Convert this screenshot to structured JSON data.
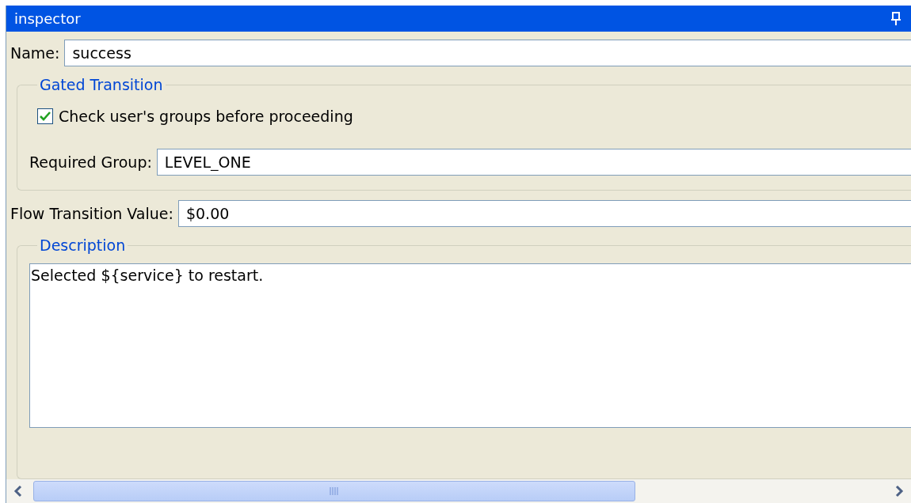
{
  "window": {
    "title": "inspector"
  },
  "name": {
    "label": "Name:",
    "value": "success"
  },
  "gated_transition": {
    "title": "Gated Transition",
    "checkbox": {
      "label": "Check user's groups before proceeding",
      "checked": true
    },
    "required_group": {
      "label": "Required Group:",
      "value": "LEVEL_ONE"
    }
  },
  "flow_transition_value": {
    "label": "Flow Transition Value:",
    "value": "$0.00"
  },
  "description": {
    "title": "Description",
    "value": "Selected ${service} to restart."
  }
}
